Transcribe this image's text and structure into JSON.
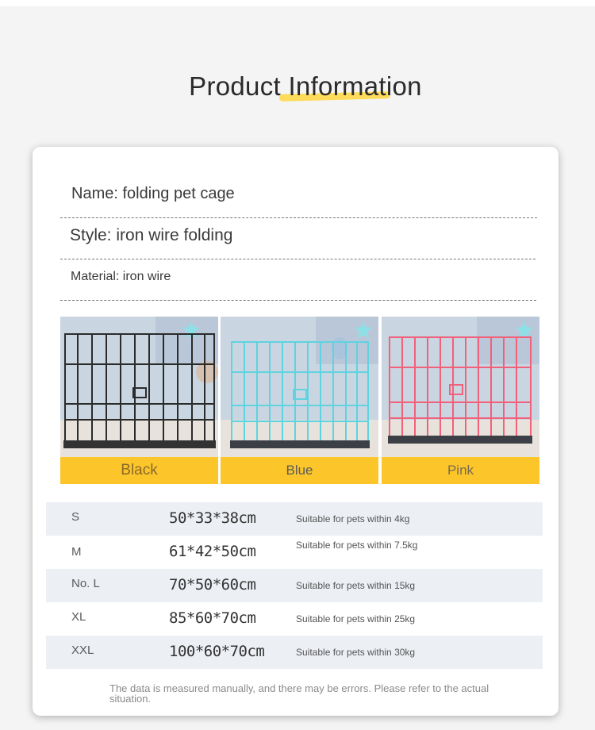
{
  "header": {
    "title": "Product Information"
  },
  "info": {
    "name": "Name: folding pet cage",
    "style": "Style: iron wire folding",
    "material": "Material: iron wire"
  },
  "colors": [
    {
      "label": "Black",
      "wire": "#2b2b2b"
    },
    {
      "label": "Blue",
      "wire": "#5fd3df"
    },
    {
      "label": "Pink",
      "wire": "#f2607a"
    }
  ],
  "sizes": [
    {
      "label": "S",
      "dims": "50*33*38cm",
      "note": "Suitable for pets within 4kg"
    },
    {
      "label": "M",
      "dims": "61*42*50cm",
      "note": "Suitable for pets within 7.5kg"
    },
    {
      "label": "No. L",
      "dims": "70*50*60cm",
      "note": "Suitable for pets within 15kg"
    },
    {
      "label": "XL",
      "dims": "85*60*70cm",
      "note": "Suitable for pets within 25kg"
    },
    {
      "label": "XXL",
      "dims": "100*60*70cm",
      "note": "Suitable for pets within 30kg"
    }
  ],
  "footnote": "The data is measured manually, and there may be errors. Please refer to the actual situation.",
  "accent_color": "#fcc52a",
  "row_shade_color": "#eceff4"
}
